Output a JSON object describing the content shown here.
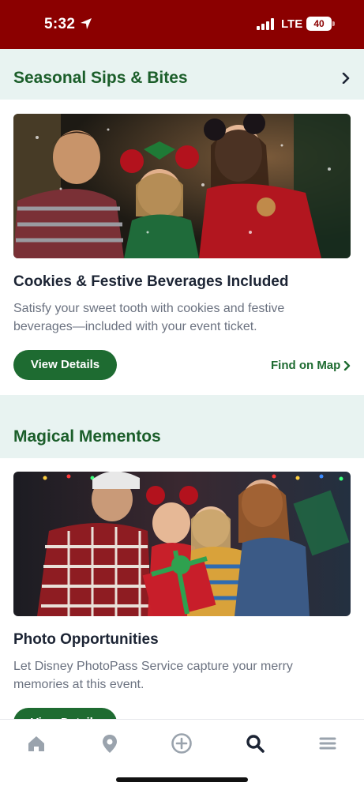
{
  "status_bar": {
    "time": "5:32",
    "network": "LTE",
    "battery": "40",
    "background_color": "#8b0000"
  },
  "sections": [
    {
      "title": "Seasonal Sips & Bites",
      "has_chevron": true,
      "cards": [
        {
          "image_icon": "photo-kids-cookies",
          "title": "Cookies & Festive Beverages Included",
          "description_line1": "Satisfy your sweet tooth with cookies and festive",
          "description_line2": "beverages—included with your event ticket.",
          "primary_button": "View Details",
          "secondary_link": "Find on Map"
        }
      ]
    },
    {
      "title": "Magical Mementos",
      "has_chevron": false,
      "cards": [
        {
          "image_icon": "photo-family-gift",
          "title": "Photo Opportunities",
          "description_line1": "Let Disney PhotoPass Service capture your merry",
          "description_line2": "memories at this event.",
          "primary_button": "View Details"
        }
      ]
    }
  ],
  "tab_bar": {
    "items": [
      {
        "icon": "home-icon",
        "active": false
      },
      {
        "icon": "map-pin-icon",
        "active": false
      },
      {
        "icon": "plus-circle-icon",
        "active": false
      },
      {
        "icon": "search-icon",
        "active": true
      },
      {
        "icon": "menu-icon",
        "active": false
      }
    ],
    "active_color": "#1c2434",
    "inactive_color": "#9aa3ad"
  },
  "colors": {
    "accent_green": "#1e6b31",
    "section_title_green": "#1b5e2a",
    "section_header_bg": "#e8f3f1"
  }
}
